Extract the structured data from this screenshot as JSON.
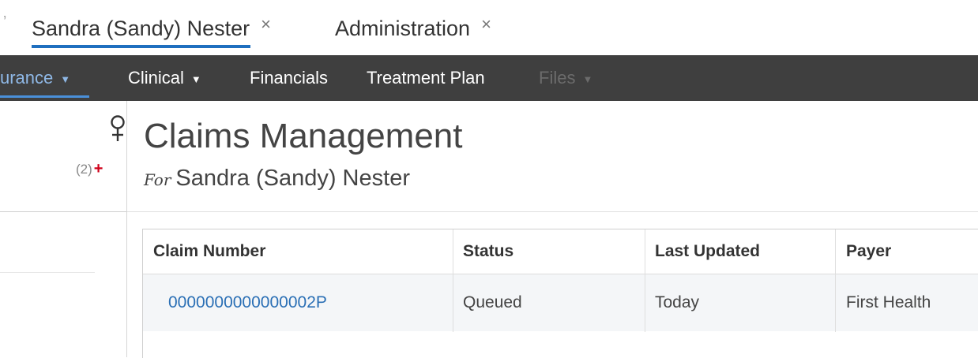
{
  "tabs": [
    {
      "label": "Sandra (Sandy) Nester",
      "active": true
    },
    {
      "label": "Administration",
      "active": false
    }
  ],
  "tab_close_glyph": "×",
  "nav": {
    "insurance": "urance",
    "clinical": "Clinical",
    "financials": "Financials",
    "treatment_plan": "Treatment Plan",
    "files": "Files"
  },
  "sidebar": {
    "gender_icon": "female-icon",
    "alerts_count": "(2)",
    "alerts_plus": "+"
  },
  "page": {
    "title": "Claims Management",
    "for_label": "For",
    "patient_name": "Sandra (Sandy) Nester"
  },
  "table": {
    "headers": [
      "Claim Number",
      "Status",
      "Last Updated",
      "Payer"
    ],
    "rows": [
      {
        "claim_number": "0000000000000002P",
        "status": "Queued",
        "last_updated": "Today",
        "payer": "First Health"
      }
    ]
  },
  "colors": {
    "accent": "#1f6fbf",
    "navbar": "#3f3f3f",
    "link": "#2a6fb5",
    "alert": "#d0021b"
  }
}
